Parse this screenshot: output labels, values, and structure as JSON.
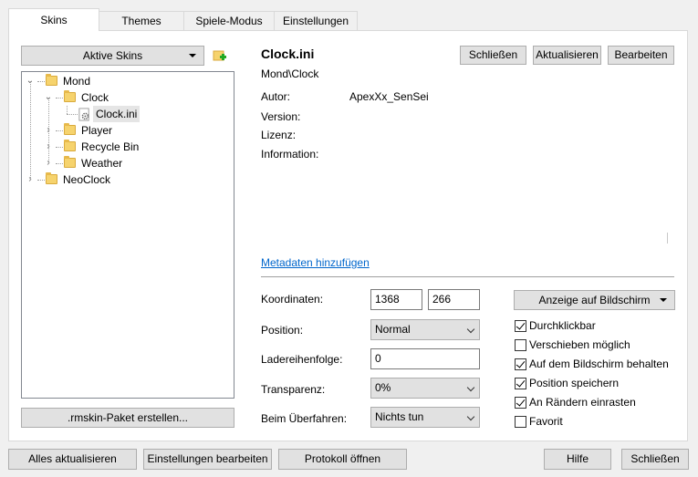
{
  "tabs": [
    {
      "label": "Skins",
      "active": true
    },
    {
      "label": "Themes",
      "active": false
    },
    {
      "label": "Spiele-Modus",
      "active": false
    },
    {
      "label": "Einstellungen",
      "active": false
    }
  ],
  "left": {
    "active_skins_label": "Aktive Skins",
    "add_icon": "add-folder-icon",
    "tree": [
      {
        "label": "Mond"
      },
      {
        "label": "Clock"
      },
      {
        "label": "Clock.ini"
      },
      {
        "label": "Player"
      },
      {
        "label": "Recycle Bin"
      },
      {
        "label": "Weather"
      },
      {
        "label": "NeoClock"
      }
    ],
    "rmskin_button": ".rmskin-Paket erstellen..."
  },
  "detail": {
    "title": "Clock.ini",
    "path": "Mond\\Clock",
    "buttons": {
      "close": "Schließen",
      "refresh": "Aktualisieren",
      "edit": "Bearbeiten"
    },
    "meta": {
      "author_label": "Autor:",
      "author_value": "ApexXx_SenSei",
      "version_label": "Version:",
      "license_label": "Lizenz:",
      "info_label": "Information:"
    },
    "add_metadata_link": "Metadaten hinzufügen",
    "settings": {
      "coords_label": "Koordinaten:",
      "coord_x": "1368",
      "coord_y": "266",
      "position_label": "Position:",
      "position_value": "Normal",
      "load_order_label": "Ladereihenfolge:",
      "load_order_value": "0",
      "transparency_label": "Transparenz:",
      "transparency_value": "0%",
      "hover_label": "Beim Überfahren:",
      "hover_value": "Nichts tun"
    },
    "display_button": "Anzeige auf Bildschirm",
    "checkboxes": [
      {
        "label": "Durchklickbar",
        "checked": true
      },
      {
        "label": "Verschieben möglich",
        "checked": false
      },
      {
        "label": "Auf dem Bildschirm behalten",
        "checked": true
      },
      {
        "label": "Position speichern",
        "checked": true
      },
      {
        "label": "An Rändern einrasten",
        "checked": true
      },
      {
        "label": "Favorit",
        "checked": false
      }
    ]
  },
  "footer": {
    "refresh_all": "Alles aktualisieren",
    "edit_settings": "Einstellungen bearbeiten",
    "open_log": "Protokoll öffnen",
    "help": "Hilfe",
    "close": "Schließen"
  }
}
